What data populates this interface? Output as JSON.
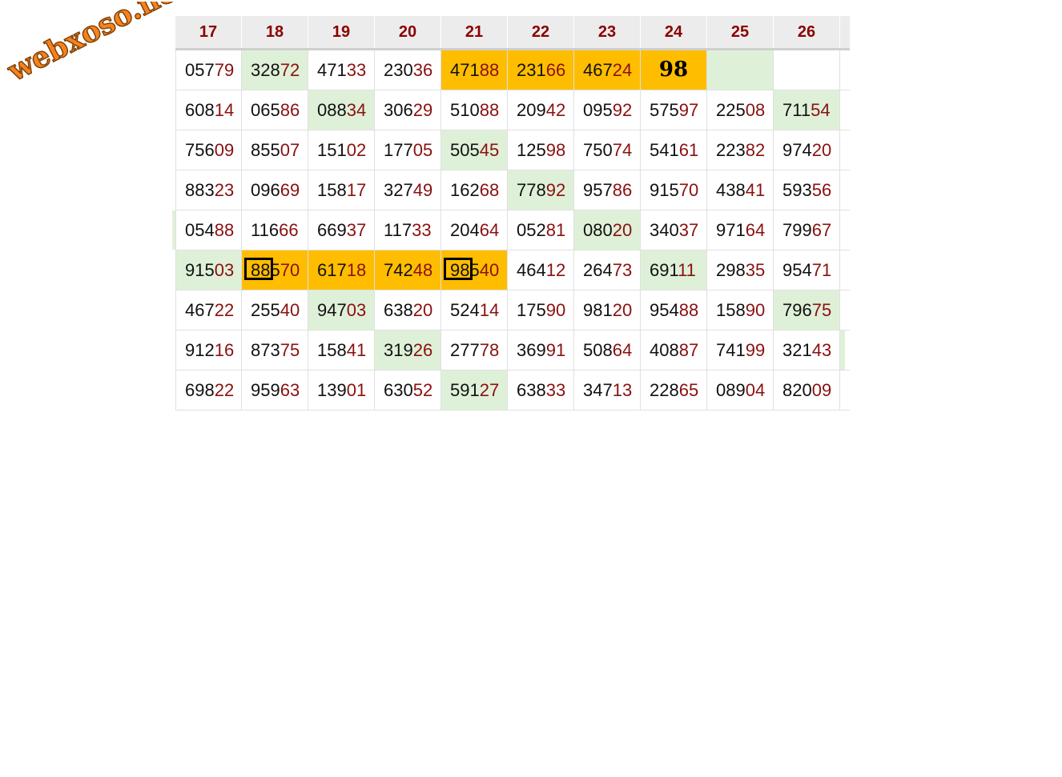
{
  "watermark": "webxoso.net",
  "colors": {
    "header_text": "#8b0000",
    "green_cell": "#dff0d8",
    "orange_cell": "#ffbd00",
    "tail_digits": "#8b1010"
  },
  "headers": [
    "17",
    "18",
    "19",
    "20",
    "21",
    "22",
    "23",
    "24",
    "25",
    "26"
  ],
  "rows": [
    [
      {
        "v": "05779"
      },
      {
        "v": "32872",
        "bg": "green"
      },
      {
        "v": "47133"
      },
      {
        "v": "23036"
      },
      {
        "v": "47188",
        "bg": "orange"
      },
      {
        "v": "23166",
        "bg": "orange"
      },
      {
        "v": "46724",
        "bg": "orange"
      },
      {
        "v": "98",
        "bg": "orange",
        "big": true
      },
      {
        "v": "",
        "bg": "green"
      },
      {
        "v": ""
      }
    ],
    [
      {
        "v": "60814"
      },
      {
        "v": "06586"
      },
      {
        "v": "08834",
        "bg": "green"
      },
      {
        "v": "30629"
      },
      {
        "v": "51088"
      },
      {
        "v": "20942"
      },
      {
        "v": "09592"
      },
      {
        "v": "57597"
      },
      {
        "v": "22508"
      },
      {
        "v": "71154",
        "bg": "green"
      }
    ],
    [
      {
        "v": "75609"
      },
      {
        "v": "85507"
      },
      {
        "v": "15102"
      },
      {
        "v": "17705"
      },
      {
        "v": "50545",
        "bg": "green"
      },
      {
        "v": "12598"
      },
      {
        "v": "75074"
      },
      {
        "v": "54161"
      },
      {
        "v": "22382"
      },
      {
        "v": "97420"
      }
    ],
    [
      {
        "v": "88323"
      },
      {
        "v": "09669"
      },
      {
        "v": "15817"
      },
      {
        "v": "32749"
      },
      {
        "v": "16268"
      },
      {
        "v": "77892",
        "bg": "green"
      },
      {
        "v": "95786"
      },
      {
        "v": "91570"
      },
      {
        "v": "43841"
      },
      {
        "v": "59356"
      }
    ],
    [
      {
        "v": "05488"
      },
      {
        "v": "11666"
      },
      {
        "v": "66937"
      },
      {
        "v": "11733"
      },
      {
        "v": "20464"
      },
      {
        "v": "05281"
      },
      {
        "v": "08020",
        "bg": "green"
      },
      {
        "v": "34037"
      },
      {
        "v": "97164"
      },
      {
        "v": "79967"
      }
    ],
    [
      {
        "v": "91503",
        "bg": "green"
      },
      {
        "v": "88570",
        "bg": "orange",
        "box": true
      },
      {
        "v": "61718",
        "bg": "orange"
      },
      {
        "v": "74248",
        "bg": "orange"
      },
      {
        "v": "98540",
        "bg": "orange",
        "box": true
      },
      {
        "v": "46412"
      },
      {
        "v": "26473"
      },
      {
        "v": "69111",
        "bg": "green"
      },
      {
        "v": "29835"
      },
      {
        "v": "95471"
      }
    ],
    [
      {
        "v": "46722"
      },
      {
        "v": "25540"
      },
      {
        "v": "94703",
        "bg": "green"
      },
      {
        "v": "63820"
      },
      {
        "v": "52414"
      },
      {
        "v": "17590"
      },
      {
        "v": "98120"
      },
      {
        "v": "95488"
      },
      {
        "v": "15890"
      },
      {
        "v": "79675",
        "bg": "green"
      }
    ],
    [
      {
        "v": "91216"
      },
      {
        "v": "87375"
      },
      {
        "v": "15841"
      },
      {
        "v": "31926",
        "bg": "green"
      },
      {
        "v": "27778"
      },
      {
        "v": "36991"
      },
      {
        "v": "50864"
      },
      {
        "v": "40887"
      },
      {
        "v": "74199"
      },
      {
        "v": "32143"
      }
    ],
    [
      {
        "v": "69822"
      },
      {
        "v": "95963"
      },
      {
        "v": "13901"
      },
      {
        "v": "63052"
      },
      {
        "v": "59127",
        "bg": "green"
      },
      {
        "v": "63833"
      },
      {
        "v": "34713"
      },
      {
        "v": "22865"
      },
      {
        "v": "08904"
      },
      {
        "v": "82009"
      }
    ]
  ]
}
